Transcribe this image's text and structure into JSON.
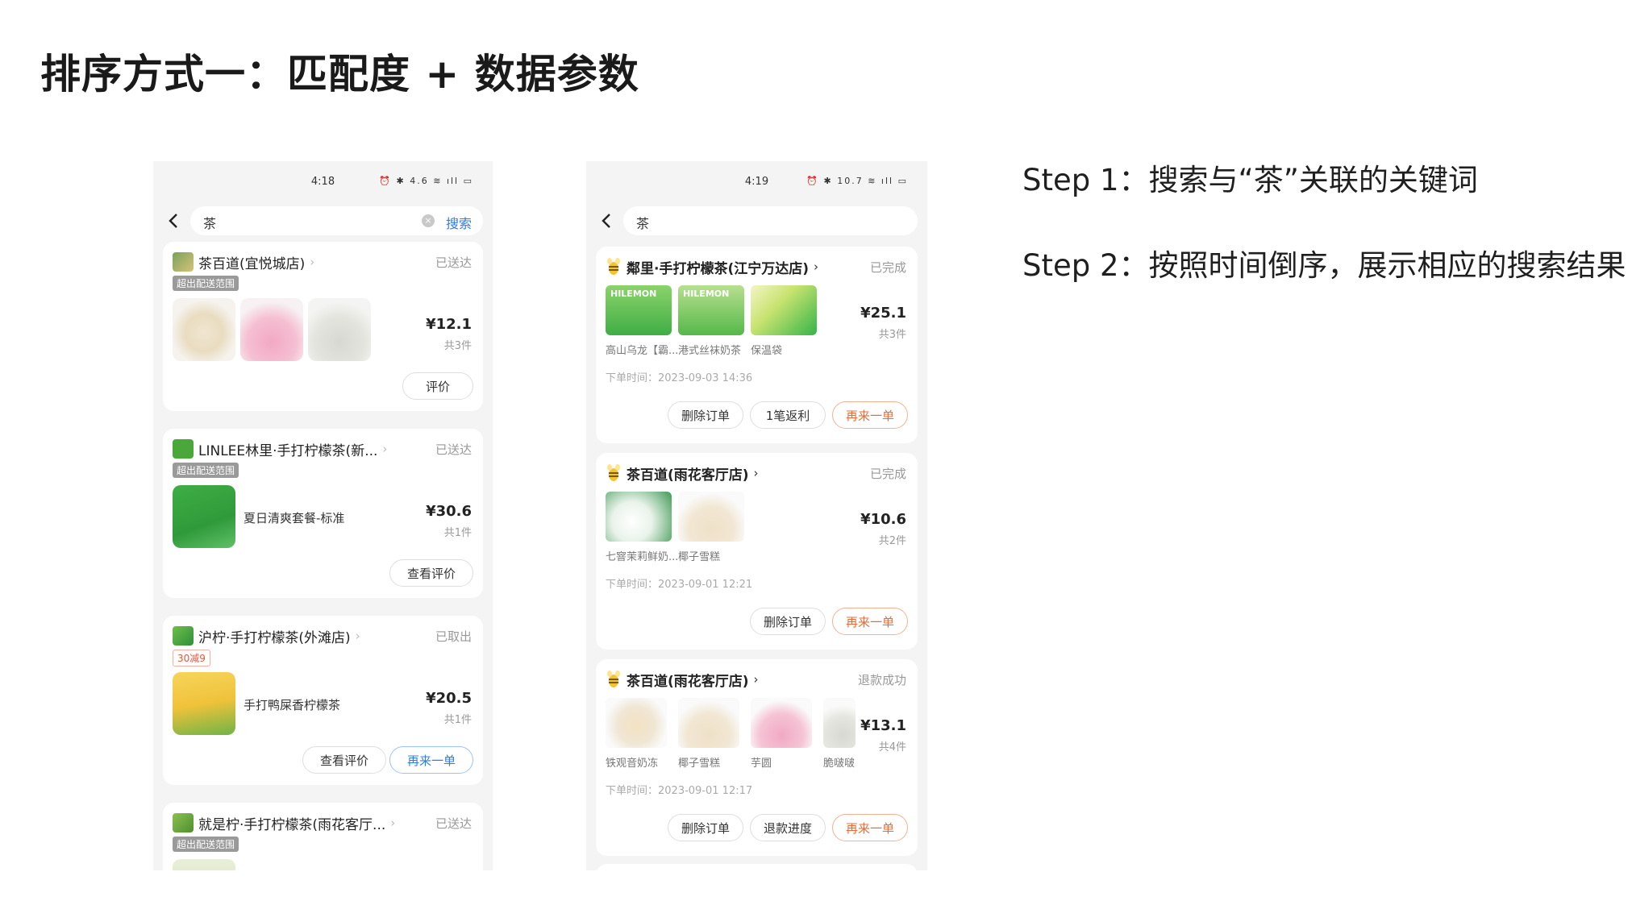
{
  "slide": {
    "title": "排序方式一：匹配度 + 数据参数",
    "steps": [
      "Step 1：搜索与“茶”关联的关键词",
      "Step 2：按照时间倒序，展示相应的搜索结果"
    ]
  },
  "phone1": {
    "time": "4:18",
    "status_icons": "⏰ ✱ 4.6 ≋ ıll ▭",
    "query": "茶",
    "search_label": "搜索",
    "clear_glyph": "×",
    "cards": [
      {
        "store": "茶百道(宜悦城店)",
        "status": "已送达",
        "tag": "超出配送范围",
        "price": "¥12.1",
        "count": "共3件",
        "buttons": [
          "评价"
        ]
      },
      {
        "store": "LINLEE林里·手打柠檬茶(新...",
        "status": "已送达",
        "tag": "超出配送范围",
        "item": "夏日清爽套餐-标准",
        "price": "¥30.6",
        "count": "共1件",
        "buttons": [
          "查看评价"
        ]
      },
      {
        "store": "沪柠·手打柠檬茶(外滩店)",
        "status": "已取出",
        "tag": "30减9",
        "item": "手打鸭屎香柠檬茶",
        "price": "¥20.5",
        "count": "共1件",
        "buttons": [
          "查看评价",
          "再来一单"
        ]
      },
      {
        "store": "就是柠·手打柠檬茶(雨花客厅...",
        "status": "已送达",
        "tag": "超出配送范围"
      }
    ]
  },
  "phone2": {
    "time": "4:19",
    "status_icons": "⏰ ✱ 10.7 ≋ ıll ▭",
    "query": "茶",
    "cards": [
      {
        "store": "鄰里·手打柠檬茶(江宁万达店)",
        "status": "已完成",
        "items": [
          "高山乌龙【霸...",
          "港式丝袜奶茶",
          "保温袋"
        ],
        "thumb_texts": [
          "HILEMON",
          "HILEMON"
        ],
        "price": "¥25.1",
        "count": "共3件",
        "order_time": "下单时间：2023-09-03 14:36",
        "buttons": [
          "删除订单",
          "1笔返利",
          "再来一单"
        ]
      },
      {
        "store": "茶百道(雨花客厅店)",
        "status": "已完成",
        "items": [
          "七窨茉莉鲜奶...",
          "椰子雪糕"
        ],
        "price": "¥10.6",
        "count": "共2件",
        "order_time": "下单时间：2023-09-01 12:21",
        "buttons": [
          "删除订单",
          "再来一单"
        ]
      },
      {
        "store": "茶百道(雨花客厅店)",
        "status": "退款成功",
        "items": [
          "铁观音奶冻",
          "椰子雪糕",
          "芋圆",
          "脆啵啵"
        ],
        "price": "¥13.1",
        "count": "共4件",
        "order_time": "下单时间：2023-09-01 12:17",
        "buttons": [
          "删除订单",
          "退款进度",
          "再来一单"
        ]
      }
    ]
  },
  "colors": {
    "blue": "#2a7cf0",
    "orange": "#ef6a32",
    "page_bg": "#f4f4f4"
  }
}
